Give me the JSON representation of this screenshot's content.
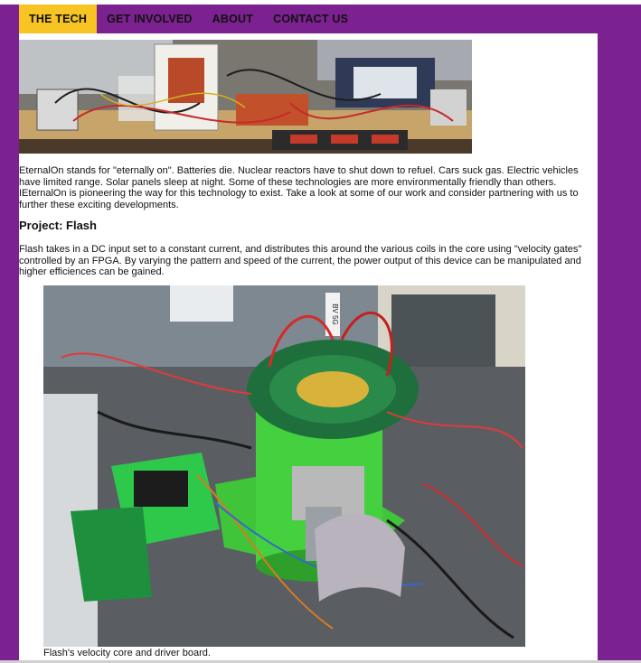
{
  "nav": {
    "items": [
      {
        "label": "THE TECH",
        "active": true
      },
      {
        "label": "GET INVOLVED",
        "active": false
      },
      {
        "label": "ABOUT",
        "active": false
      },
      {
        "label": "CONTACT US",
        "active": false
      }
    ]
  },
  "colors": {
    "frame": "#7b2190",
    "active_tab": "#f7c423",
    "content_bg": "#ffffff"
  },
  "intro": {
    "text": "EternalOn stands for \"eternally on\". Batteries die. Nuclear reactors have to shut down to refuel. Cars suck gas. Electric vehicles have limited range. Solar panels sleep at night. Some of these technologies are more environmentally friendly than others. IEternalOn is pioneering the way for this technology to exist. Take a look at some of our work and consider partnering with us to further these exciting developments."
  },
  "project": {
    "heading": "Project: Flash",
    "description": "Flash takes in a DC input set to a constant current, and distributes this around the various coils in the core using \"velocity gates\" controlled by an FPGA. By varying the pattern and speed of the current, the power output of this device can be manipulated and higher efficiences can be gained.",
    "photo_caption": "Flash's velocity core and driver board.",
    "photo_label_tag": "BV 5G"
  }
}
